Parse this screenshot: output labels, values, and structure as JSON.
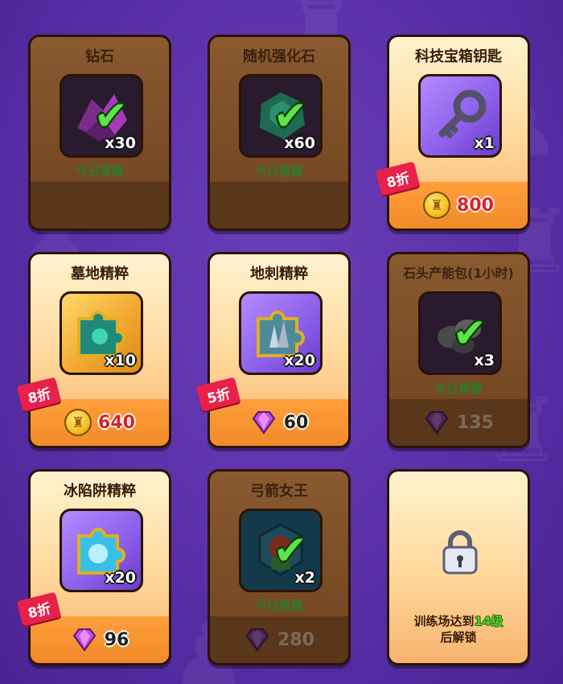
{
  "colors": {
    "active_price_bar": "#f28a2a",
    "discount_ribbon": "#e8214a",
    "sold_label": "#2f7a26",
    "level_highlight": "#57d12f",
    "price_red": "#d3242a"
  },
  "cards": [
    {
      "title": "钻石",
      "icon": "purple-gems-icon",
      "qty": "x30",
      "status": "今日售罄",
      "price": "",
      "currency": "",
      "discount": ""
    },
    {
      "title": "随机强化石",
      "icon": "green-stone-icon",
      "qty": "x60",
      "status": "今日售罄",
      "price": "",
      "currency": "",
      "discount": ""
    },
    {
      "title": "科技宝箱钥匙",
      "icon": "key-icon",
      "qty": "x1",
      "status": "",
      "price": "800",
      "currency": "coin-icon",
      "discount": "8折"
    },
    {
      "title": "墓地精粹",
      "icon": "puzzle-piece-icon",
      "qty": "x10",
      "status": "",
      "price": "640",
      "currency": "coin-icon",
      "discount": "8折"
    },
    {
      "title": "地刺精粹",
      "icon": "puzzle-piece-icon",
      "qty": "x20",
      "status": "",
      "price": "60",
      "currency": "gem-icon",
      "discount": "5折"
    },
    {
      "title": "石头产能包(1小时)",
      "icon": "stone-pack-icon",
      "qty": "x3",
      "status": "今日售罄",
      "price": "135",
      "currency": "gem-icon",
      "discount": ""
    },
    {
      "title": "冰陷阱精粹",
      "icon": "puzzle-piece-icon",
      "qty": "x20",
      "status": "",
      "price": "96",
      "currency": "gem-icon",
      "discount": "8折"
    },
    {
      "title": "弓箭女王",
      "icon": "archer-queen-icon",
      "qty": "x2",
      "status": "今日售罄",
      "price": "280",
      "currency": "gem-icon",
      "discount": ""
    },
    {
      "title": "",
      "icon": "padlock-icon",
      "qty": "",
      "status": "",
      "price": "",
      "currency": "",
      "discount": "",
      "unlock_prefix": "训练场达到",
      "unlock_level": "14级",
      "unlock_suffix": "后解锁"
    }
  ]
}
